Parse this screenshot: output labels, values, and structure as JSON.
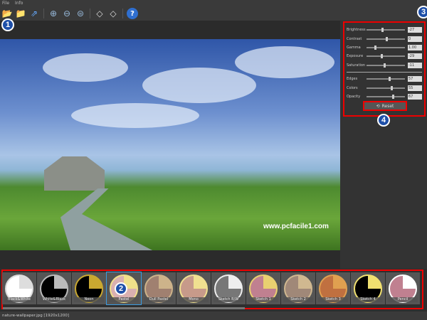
{
  "menu": [
    "File",
    "Info"
  ],
  "toolbar": [
    "open-folder",
    "save-folder",
    "export",
    "zoom-in",
    "zoom-out",
    "zoom-fit",
    "rotate-left",
    "rotate-right",
    "help"
  ],
  "badges": [
    "1",
    "2",
    "3",
    "4"
  ],
  "watermark": "www.pcfacile1.com",
  "sliders": [
    {
      "label": "Brightness",
      "value": "-27",
      "pos": 0.38
    },
    {
      "label": "Contrast",
      "value": "0",
      "pos": 0.5
    },
    {
      "label": "Gamma",
      "value": "1.00",
      "pos": 0.2
    },
    {
      "label": "Exposure",
      "value": "-29",
      "pos": 0.37
    },
    {
      "label": "Saturation",
      "value": "-11",
      "pos": 0.45
    }
  ],
  "sliders2": [
    {
      "label": "Edges",
      "value": "57",
      "pos": 0.57
    },
    {
      "label": "Colors",
      "value": "55",
      "pos": 0.63
    },
    {
      "label": "Opacity",
      "value": "67",
      "pos": 0.67
    }
  ],
  "reset_label": "Reset",
  "filters": [
    {
      "name": "Black&White",
      "bg": "#fff",
      "ring": "#ddd"
    },
    {
      "name": "White&Black",
      "bg": "#000",
      "ring": "#bbb"
    },
    {
      "name": "Neon",
      "bg": "#000",
      "ring": "#c9a830"
    },
    {
      "name": "Pastel",
      "bg": "#d9b0b0",
      "ring": "#f0e08a"
    },
    {
      "name": "Dull Pastel",
      "bg": "#a08070",
      "ring": "#cdb38a"
    },
    {
      "name": "Mono",
      "bg": "#c79a8a",
      "ring": "#f0e090"
    },
    {
      "name": "Sketch B/W",
      "bg": "#777",
      "ring": "#eee"
    },
    {
      "name": "Sketch 1",
      "bg": "#c08090",
      "ring": "#e8d070"
    },
    {
      "name": "Sketch 2",
      "bg": "#a08878",
      "ring": "#d0b890"
    },
    {
      "name": "Sketch 3",
      "bg": "#c07040",
      "ring": "#e0a050"
    },
    {
      "name": "Sketch 4",
      "bg": "#000",
      "ring": "#f0e070"
    },
    {
      "name": "Pencil",
      "bg": "#c08090",
      "ring": "#fff"
    }
  ],
  "status": "nature-wallpaper.jpg [1920x1200]"
}
